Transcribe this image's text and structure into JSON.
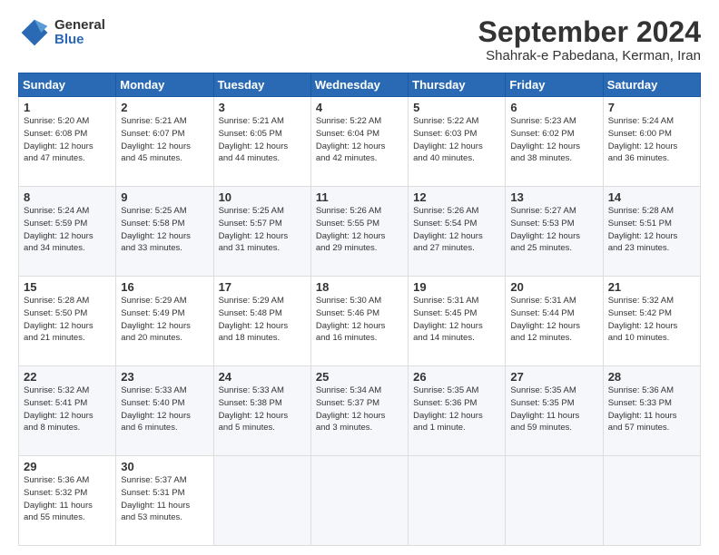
{
  "header": {
    "logo_general": "General",
    "logo_blue": "Blue",
    "title": "September 2024",
    "subtitle": "Shahrak-e Pabedana, Kerman, Iran"
  },
  "weekdays": [
    "Sunday",
    "Monday",
    "Tuesday",
    "Wednesday",
    "Thursday",
    "Friday",
    "Saturday"
  ],
  "weeks": [
    [
      {
        "day": "1",
        "info": "Sunrise: 5:20 AM\nSunset: 6:08 PM\nDaylight: 12 hours\nand 47 minutes."
      },
      {
        "day": "2",
        "info": "Sunrise: 5:21 AM\nSunset: 6:07 PM\nDaylight: 12 hours\nand 45 minutes."
      },
      {
        "day": "3",
        "info": "Sunrise: 5:21 AM\nSunset: 6:05 PM\nDaylight: 12 hours\nand 44 minutes."
      },
      {
        "day": "4",
        "info": "Sunrise: 5:22 AM\nSunset: 6:04 PM\nDaylight: 12 hours\nand 42 minutes."
      },
      {
        "day": "5",
        "info": "Sunrise: 5:22 AM\nSunset: 6:03 PM\nDaylight: 12 hours\nand 40 minutes."
      },
      {
        "day": "6",
        "info": "Sunrise: 5:23 AM\nSunset: 6:02 PM\nDaylight: 12 hours\nand 38 minutes."
      },
      {
        "day": "7",
        "info": "Sunrise: 5:24 AM\nSunset: 6:00 PM\nDaylight: 12 hours\nand 36 minutes."
      }
    ],
    [
      {
        "day": "8",
        "info": "Sunrise: 5:24 AM\nSunset: 5:59 PM\nDaylight: 12 hours\nand 34 minutes."
      },
      {
        "day": "9",
        "info": "Sunrise: 5:25 AM\nSunset: 5:58 PM\nDaylight: 12 hours\nand 33 minutes."
      },
      {
        "day": "10",
        "info": "Sunrise: 5:25 AM\nSunset: 5:57 PM\nDaylight: 12 hours\nand 31 minutes."
      },
      {
        "day": "11",
        "info": "Sunrise: 5:26 AM\nSunset: 5:55 PM\nDaylight: 12 hours\nand 29 minutes."
      },
      {
        "day": "12",
        "info": "Sunrise: 5:26 AM\nSunset: 5:54 PM\nDaylight: 12 hours\nand 27 minutes."
      },
      {
        "day": "13",
        "info": "Sunrise: 5:27 AM\nSunset: 5:53 PM\nDaylight: 12 hours\nand 25 minutes."
      },
      {
        "day": "14",
        "info": "Sunrise: 5:28 AM\nSunset: 5:51 PM\nDaylight: 12 hours\nand 23 minutes."
      }
    ],
    [
      {
        "day": "15",
        "info": "Sunrise: 5:28 AM\nSunset: 5:50 PM\nDaylight: 12 hours\nand 21 minutes."
      },
      {
        "day": "16",
        "info": "Sunrise: 5:29 AM\nSunset: 5:49 PM\nDaylight: 12 hours\nand 20 minutes."
      },
      {
        "day": "17",
        "info": "Sunrise: 5:29 AM\nSunset: 5:48 PM\nDaylight: 12 hours\nand 18 minutes."
      },
      {
        "day": "18",
        "info": "Sunrise: 5:30 AM\nSunset: 5:46 PM\nDaylight: 12 hours\nand 16 minutes."
      },
      {
        "day": "19",
        "info": "Sunrise: 5:31 AM\nSunset: 5:45 PM\nDaylight: 12 hours\nand 14 minutes."
      },
      {
        "day": "20",
        "info": "Sunrise: 5:31 AM\nSunset: 5:44 PM\nDaylight: 12 hours\nand 12 minutes."
      },
      {
        "day": "21",
        "info": "Sunrise: 5:32 AM\nSunset: 5:42 PM\nDaylight: 12 hours\nand 10 minutes."
      }
    ],
    [
      {
        "day": "22",
        "info": "Sunrise: 5:32 AM\nSunset: 5:41 PM\nDaylight: 12 hours\nand 8 minutes."
      },
      {
        "day": "23",
        "info": "Sunrise: 5:33 AM\nSunset: 5:40 PM\nDaylight: 12 hours\nand 6 minutes."
      },
      {
        "day": "24",
        "info": "Sunrise: 5:33 AM\nSunset: 5:38 PM\nDaylight: 12 hours\nand 5 minutes."
      },
      {
        "day": "25",
        "info": "Sunrise: 5:34 AM\nSunset: 5:37 PM\nDaylight: 12 hours\nand 3 minutes."
      },
      {
        "day": "26",
        "info": "Sunrise: 5:35 AM\nSunset: 5:36 PM\nDaylight: 12 hours\nand 1 minute."
      },
      {
        "day": "27",
        "info": "Sunrise: 5:35 AM\nSunset: 5:35 PM\nDaylight: 11 hours\nand 59 minutes."
      },
      {
        "day": "28",
        "info": "Sunrise: 5:36 AM\nSunset: 5:33 PM\nDaylight: 11 hours\nand 57 minutes."
      }
    ],
    [
      {
        "day": "29",
        "info": "Sunrise: 5:36 AM\nSunset: 5:32 PM\nDaylight: 11 hours\nand 55 minutes."
      },
      {
        "day": "30",
        "info": "Sunrise: 5:37 AM\nSunset: 5:31 PM\nDaylight: 11 hours\nand 53 minutes."
      },
      {
        "day": "",
        "info": ""
      },
      {
        "day": "",
        "info": ""
      },
      {
        "day": "",
        "info": ""
      },
      {
        "day": "",
        "info": ""
      },
      {
        "day": "",
        "info": ""
      }
    ]
  ]
}
